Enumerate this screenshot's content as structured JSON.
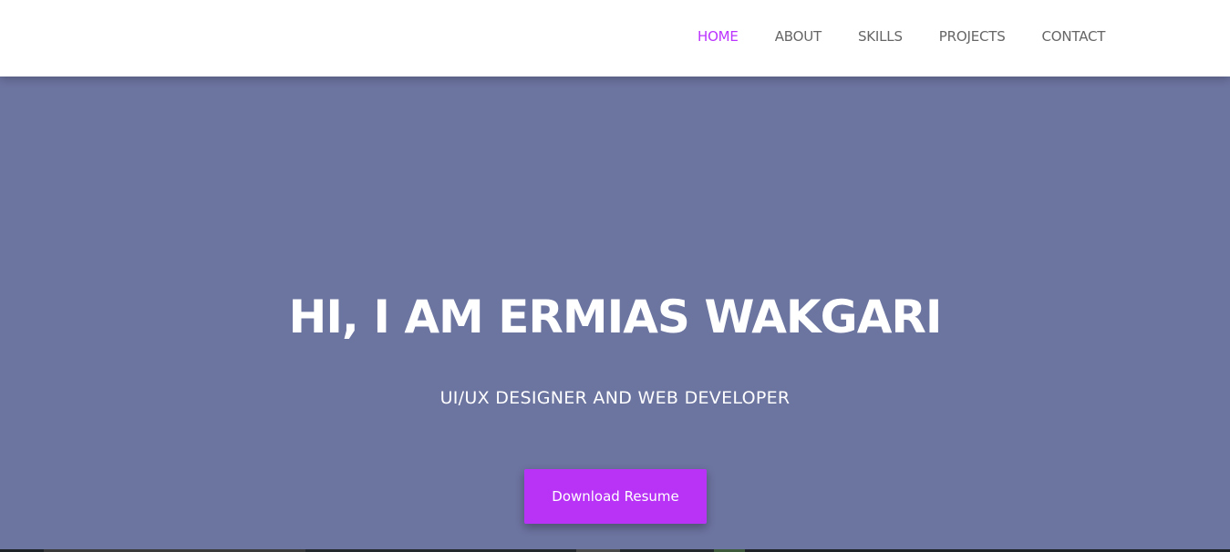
{
  "nav": {
    "items": [
      {
        "label": "HOME",
        "active": true
      },
      {
        "label": "ABOUT",
        "active": false
      },
      {
        "label": "SKILLS",
        "active": false
      },
      {
        "label": "PROJECTS",
        "active": false
      },
      {
        "label": "CONTACT",
        "active": false
      }
    ]
  },
  "hero": {
    "title": "HI, I AM ERMIAS WAKGARI",
    "subtitle": "UI/UX DESIGNER AND WEB DEVELOPER",
    "cta_label": "Download Resume"
  },
  "colors": {
    "accent": "#bb33ff",
    "hero_background": "#6c74a0",
    "nav_text": "#666666",
    "button_background": "#b833f5"
  }
}
